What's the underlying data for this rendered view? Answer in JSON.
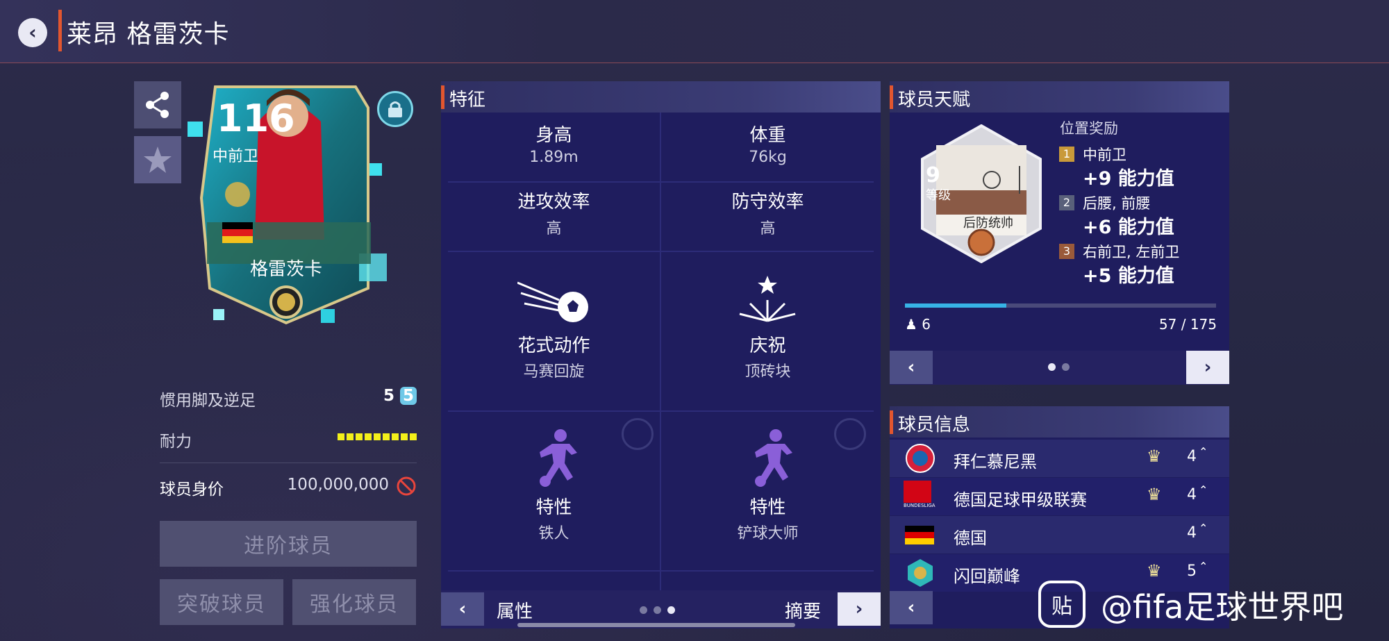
{
  "header": {
    "back_label": "‹",
    "title": "莱昂 格雷茨卡"
  },
  "card": {
    "rating": "116",
    "position": "中前卫",
    "name": "格雷茨卡"
  },
  "left": {
    "foot_label": "惯用脚及逆足",
    "foot_value": "5",
    "foot_weak": "5",
    "stamina_label": "耐力",
    "stamina_level": 9,
    "price_label": "球员身价",
    "price_value": "100,000,000",
    "promote_button": "进阶球员",
    "break_button": "突破球员",
    "enhance_button": "强化球员"
  },
  "traits": {
    "title": "特征",
    "height_label": "身高",
    "height_value": "1.89m",
    "weight_label": "体重",
    "weight_value": "76kg",
    "attack_label": "进攻效率",
    "attack_value": "高",
    "defense_label": "防守效率",
    "defense_value": "高",
    "skill_label": "花式动作",
    "skill_value": "马赛回旋",
    "celebration_label": "庆祝",
    "celebration_value": "顶砖块",
    "trait1_label": "特性",
    "trait1_value": "铁人",
    "trait2_label": "特性",
    "trait2_value": "铲球大师",
    "footer_left": "属性",
    "footer_right": "摘要"
  },
  "talent": {
    "title": "球员天赋",
    "level_num": "9",
    "level_label": "等级",
    "talent_name": "后防统帅",
    "bonus_title": "位置奖励",
    "bonuses": [
      {
        "rank": "1",
        "pos": "中前卫",
        "value": "+9 能力值",
        "color": "#c99a3a"
      },
      {
        "rank": "2",
        "pos": "后腰, 前腰",
        "value": "+6 能力值",
        "color": "#59607a"
      },
      {
        "rank": "3",
        "pos": "右前卫, 左前卫",
        "value": "+5 能力值",
        "color": "#9a5a3a"
      }
    ],
    "people_count": "6",
    "progress_text": "57 / 175",
    "progress": 0.326
  },
  "info": {
    "title": "球员信息",
    "rows": [
      {
        "name": "拜仁慕尼黑",
        "level": "4",
        "crown": true
      },
      {
        "name": "德国足球甲级联赛",
        "level": "4",
        "crown": true
      },
      {
        "name": "德国",
        "level": "4",
        "crown": false
      },
      {
        "name": "闪回巅峰",
        "level": "5",
        "crown": true
      }
    ],
    "bundesliga_text": "BUNDESLIGA"
  },
  "watermark": {
    "logo": "贴",
    "text": "@fifa足球世界吧"
  },
  "colors": {
    "accent": "#e2562f",
    "panel": "#1f1d5e",
    "progress": "#37b3e6",
    "stamina": "#f3f01a"
  }
}
